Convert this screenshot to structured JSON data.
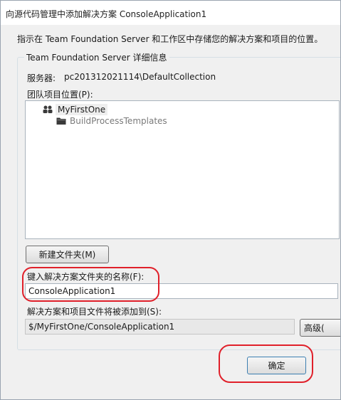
{
  "window": {
    "title": "向源代码管理中添加解决方案 ConsoleApplication1"
  },
  "description": "指示在 Team Foundation Server 和工作区中存储您的解决方案和项目的位置。",
  "details_group": {
    "label": "Team Foundation Server 详细信息",
    "server_label": "服务器:",
    "server_value": "pc201312021114\\DefaultCollection",
    "team_location_label": "团队项目位置(P):",
    "tree": {
      "root": {
        "label": "MyFirstOne",
        "icon": "team-project-icon"
      },
      "child": {
        "label": "BuildProcessTemplates",
        "icon": "folder-icon"
      }
    },
    "new_folder_button": "新建文件夹(M)",
    "name_label": "键入解决方案文件夹的名称(F):",
    "name_value": "ConsoleApplication1",
    "path_label": "解决方案和项目文件将被添加到(S):",
    "path_value": "$/MyFirstOne/ConsoleApplication1",
    "advanced_button": "高级(",
    "ok_button": "确定"
  },
  "colors": {
    "highlight": "#e0202a",
    "ok_border": "#3c7fb1"
  }
}
